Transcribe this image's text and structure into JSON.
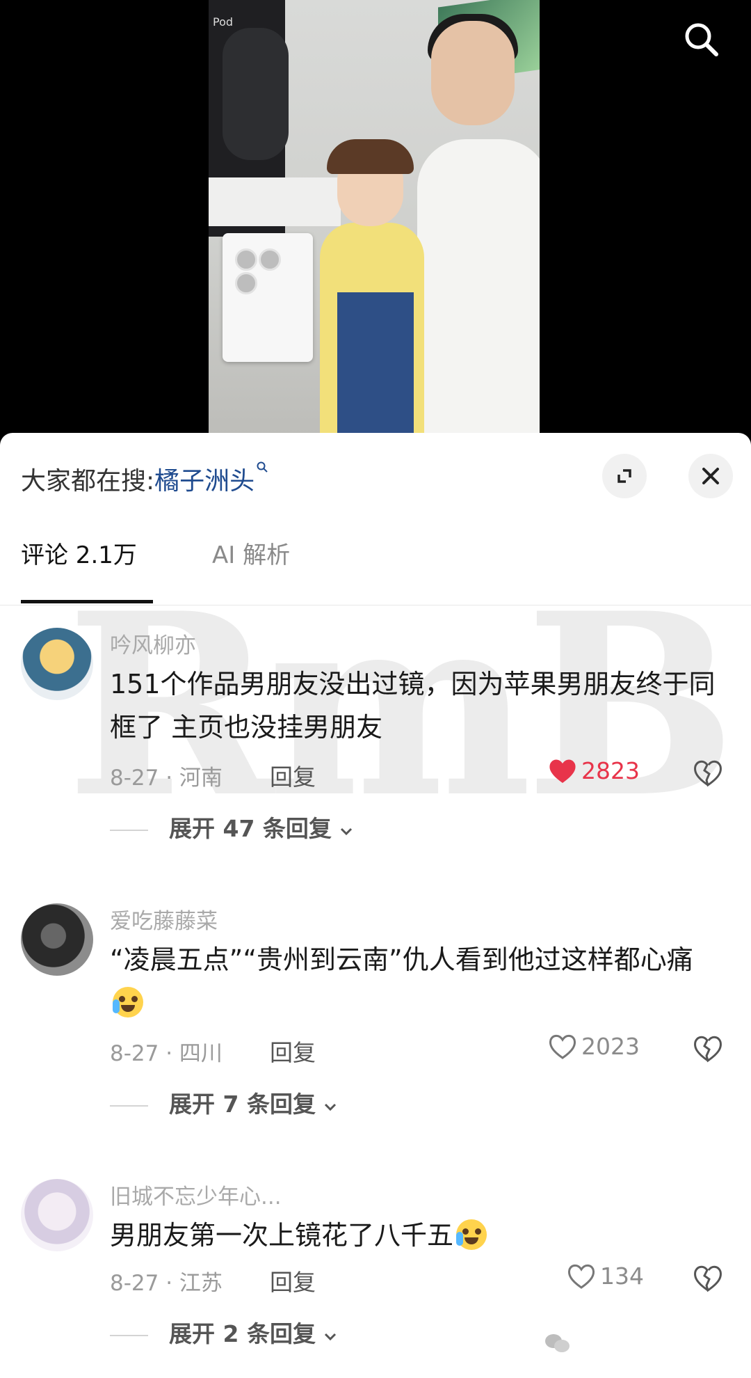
{
  "video": {
    "photo_label": "Pod"
  },
  "sheet": {
    "search_prefix": "大家都在搜:",
    "search_keyword": "橘子洲头",
    "tabs": [
      {
        "label": "评论 2.1万",
        "active": true
      },
      {
        "label": "AI 解析",
        "active": false
      }
    ]
  },
  "comments": [
    {
      "user": "吟风柳亦",
      "text": "151个作品男朋友没出过镜，因为苹果男朋友终于同框了 主页也没挂男朋友",
      "meta": "8-27 · 河南",
      "reply_label": "回复",
      "likes": "2823",
      "liked": true,
      "expand": "展开 47 条回复"
    },
    {
      "user": "爱吃藤藤菜",
      "text": "“凌晨五点”“贵州到云南”仇人看到他过这样都心痛",
      "meta": "8-27 · 四川",
      "reply_label": "回复",
      "likes": "2023",
      "liked": false,
      "expand": "展开 7 条回复"
    },
    {
      "user": "旧城不忘少年心...",
      "text": "男朋友第一次上镜花了八千五",
      "meta": "8-27 · 江苏",
      "reply_label": "回复",
      "likes": "134",
      "liked": false,
      "expand": "展开 2 条回复"
    }
  ],
  "watermark": "RmB",
  "colors": {
    "like_active": "#e8344a",
    "keyword": "#1f4b8f",
    "meta": "#9a9a9a"
  }
}
